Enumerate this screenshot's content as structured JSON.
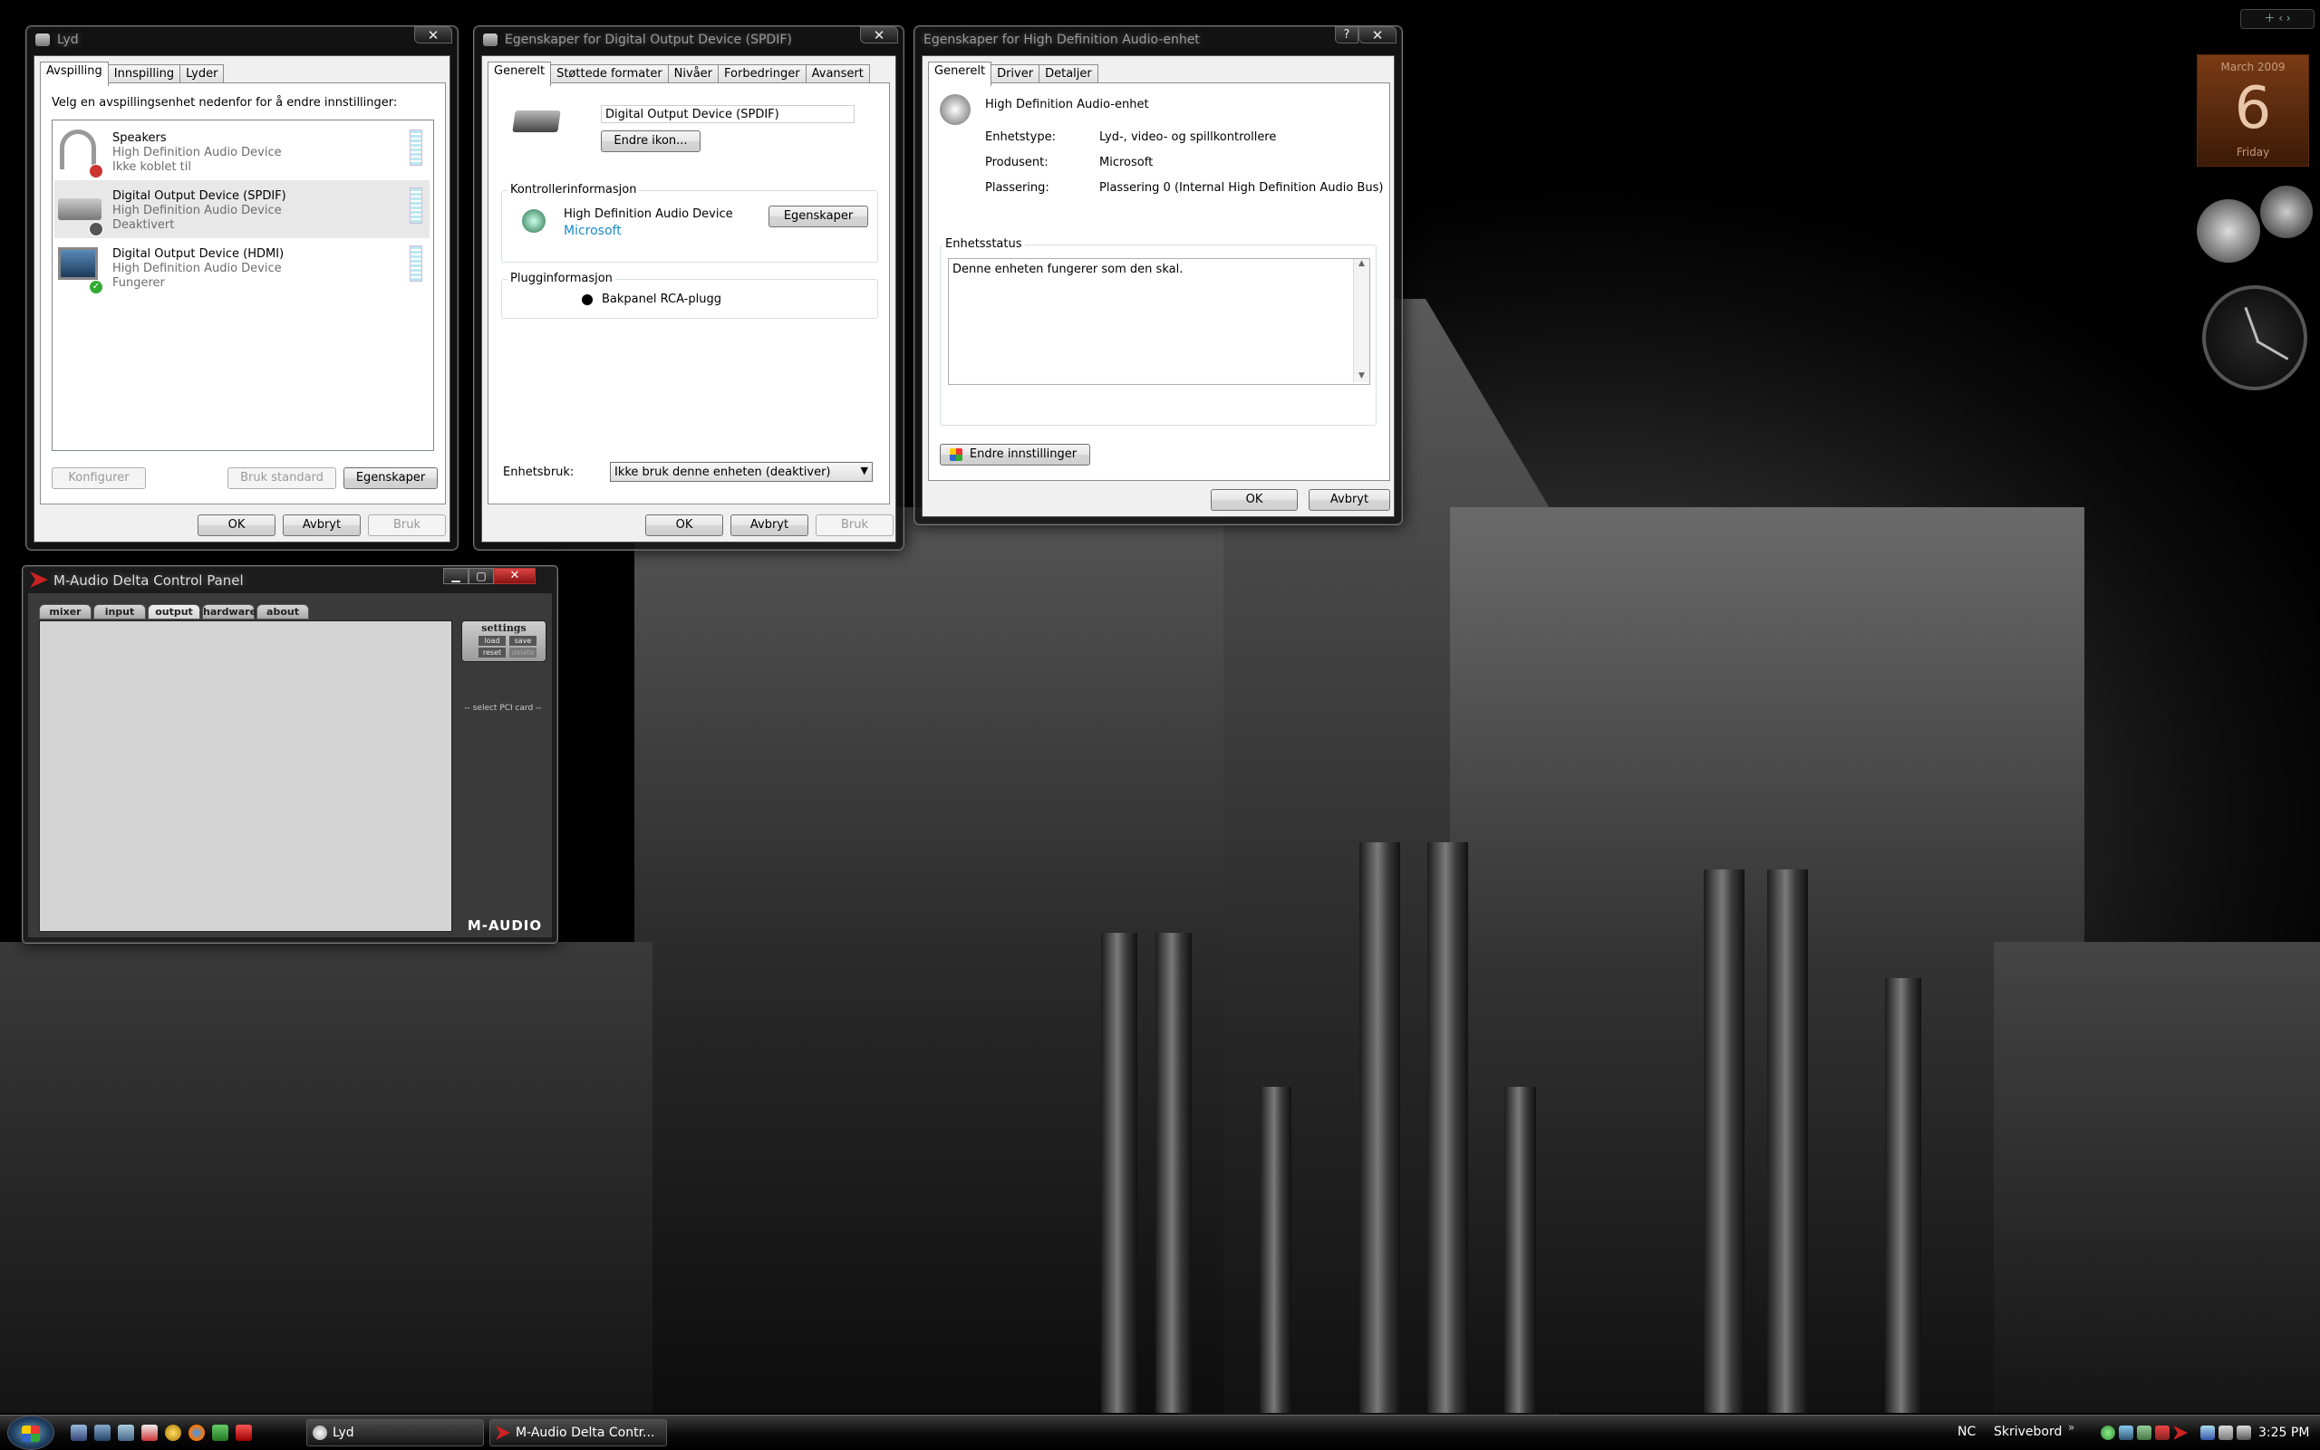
{
  "sound_window": {
    "title": "Lyd",
    "close": "✕",
    "tabs": [
      "Avspilling",
      "Innspilling",
      "Lyder"
    ],
    "instruction": "Velg en avspillingsenhet nedenfor for å endre innstillinger:",
    "devices": [
      {
        "name": "Speakers",
        "driver": "High Definition Audio Device",
        "status": "Ikke koblet til",
        "icon": "headphones-icon"
      },
      {
        "name": "Digital Output Device (SPDIF)",
        "driver": "High Definition Audio Device",
        "status": "Deaktivert",
        "icon": "spdif-device-icon"
      },
      {
        "name": "Digital Output Device (HDMI)",
        "driver": "High Definition Audio Device",
        "status": "Fungerer",
        "icon": "monitor-icon"
      }
    ],
    "buttons": {
      "configure": "Konfigurer",
      "set_default": "Bruk standard",
      "properties": "Egenskaper",
      "ok": "OK",
      "cancel": "Avbryt",
      "apply": "Bruk"
    }
  },
  "spdif_window": {
    "title": "Egenskaper for Digital Output Device (SPDIF)",
    "close": "✕",
    "tabs": [
      "Generelt",
      "Støttede formater",
      "Nivåer",
      "Forbedringer",
      "Avansert"
    ],
    "device_name": "Digital Output Device (SPDIF)",
    "change_icon": "Endre ikon...",
    "controller_group": "Kontrollerinformasjon",
    "controller_name": "High Definition Audio Device",
    "controller_link": "Microsoft",
    "controller_properties": "Egenskaper",
    "plug_group": "Plugginformasjon",
    "plug_name": "Bakpanel RCA-plugg",
    "usage_label": "Enhetsbruk:",
    "usage_value": "Ikke bruk denne enheten (deaktiver)",
    "buttons": {
      "ok": "OK",
      "cancel": "Avbryt",
      "apply": "Bruk"
    }
  },
  "hda_window": {
    "title": "Egenskaper for High Definition Audio-enhet",
    "help": "?",
    "close": "✕",
    "tabs": [
      "Generelt",
      "Driver",
      "Detaljer"
    ],
    "device_name": "High Definition Audio-enhet",
    "rows": [
      {
        "label": "Enhetstype:",
        "value": "Lyd-, video- og spillkontrollere"
      },
      {
        "label": "Produsent:",
        "value": "Microsoft"
      },
      {
        "label": "Plassering:",
        "value": "Plassering 0 (Internal High Definition Audio Bus)"
      }
    ],
    "status_group": "Enhetsstatus",
    "status_text": "Denne enheten fungerer som den skal.",
    "change_settings": "Endre innstillinger",
    "buttons": {
      "ok": "OK",
      "cancel": "Avbryt"
    }
  },
  "maudio_window": {
    "title": "M-Audio Delta Control Panel",
    "tabs": [
      "mixer",
      "input",
      "output",
      "hardware",
      "about"
    ],
    "settings_label": "settings",
    "settings_buttons": [
      "load",
      "save",
      "reset",
      "delete"
    ],
    "select_card": "-- select PCI card --",
    "brand": "M-AUDIO"
  },
  "sidebar": {
    "calendar_month": "March 2009",
    "calendar_day": "6",
    "calendar_weekday": "Friday"
  },
  "taskbar": {
    "items": [
      "Lyd",
      "M-Audio Delta Contr..."
    ],
    "language": "NC",
    "desktop_label": "Skrivebord",
    "clock": "3:25 PM"
  }
}
